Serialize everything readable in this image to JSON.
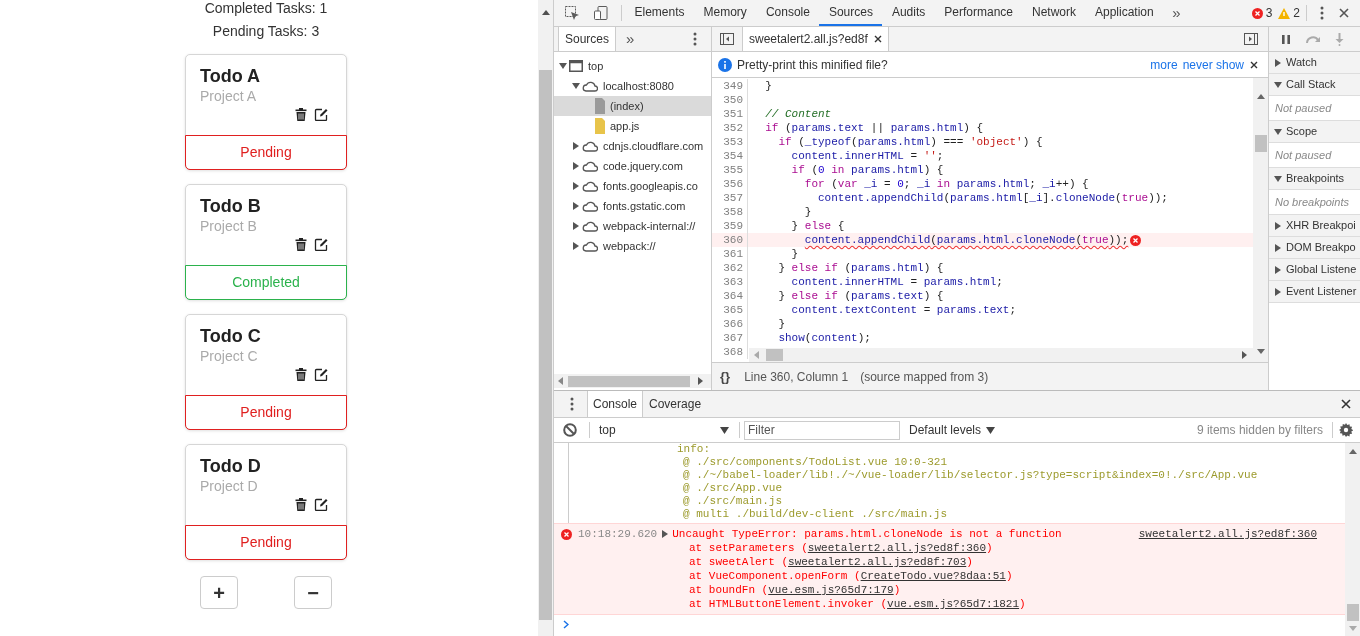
{
  "app": {
    "summary": [
      "Completed Tasks: 1",
      "Pending Tasks: 3"
    ],
    "todos": [
      {
        "title": "Todo A",
        "project": "Project A",
        "status": "Pending",
        "completed": false
      },
      {
        "title": "Todo B",
        "project": "Project B",
        "status": "Completed",
        "completed": true
      },
      {
        "title": "Todo C",
        "project": "Project C",
        "status": "Pending",
        "completed": false
      },
      {
        "title": "Todo D",
        "project": "Project D",
        "status": "Pending",
        "completed": false
      }
    ],
    "add_button": "+",
    "remove_button": "−"
  },
  "devtools": {
    "tabs": [
      {
        "label": "Elements",
        "selected": false
      },
      {
        "label": "Memory",
        "selected": false
      },
      {
        "label": "Console",
        "selected": false
      },
      {
        "label": "Sources",
        "selected": true
      },
      {
        "label": "Audits",
        "selected": false
      },
      {
        "label": "Performance",
        "selected": false
      },
      {
        "label": "Network",
        "selected": false
      },
      {
        "label": "Application",
        "selected": false
      }
    ],
    "more_tabs": "»",
    "error_count": "3",
    "warning_count": "2",
    "navigator": {
      "tab": "Sources",
      "more": "»",
      "tree": [
        {
          "label": "top",
          "kind": "frame",
          "expanded": true,
          "selected": false,
          "children": [
            {
              "label": "localhost:8080",
              "kind": "domain",
              "expanded": true,
              "selected": false,
              "children": [
                {
                  "label": "(index)",
                  "kind": "page",
                  "selected": true
                },
                {
                  "label": "app.js",
                  "kind": "script",
                  "selected": false
                }
              ]
            },
            {
              "label": "cdnjs.cloudflare.com",
              "kind": "domain",
              "expanded": false,
              "selected": false
            },
            {
              "label": "code.jquery.com",
              "kind": "domain",
              "expanded": false,
              "selected": false
            },
            {
              "label": "fonts.googleapis.co",
              "kind": "domain",
              "expanded": false,
              "selected": false
            },
            {
              "label": "fonts.gstatic.com",
              "kind": "domain",
              "expanded": false,
              "selected": false
            },
            {
              "label": "webpack-internal://",
              "kind": "domain",
              "expanded": false,
              "selected": false
            },
            {
              "label": "webpack://",
              "kind": "domain",
              "expanded": false,
              "selected": false
            }
          ]
        }
      ]
    },
    "editor": {
      "file_tab": "sweetalert2.all.js?ed8f",
      "infobar": {
        "message": "Pretty-print this minified file?",
        "links": [
          "more",
          "never show"
        ]
      },
      "lines": [
        {
          "number": "349",
          "error": false,
          "segments": [
            {
              "kind": "plain",
              "text": "  }"
            }
          ]
        },
        {
          "number": "350",
          "error": false
        },
        {
          "number": "351",
          "error": false,
          "segments": [
            {
              "kind": "comment",
              "text": "  // Content"
            }
          ]
        },
        {
          "number": "352",
          "error": false,
          "segments": [
            {
              "kind": "keyword",
              "text": "  if"
            },
            {
              "kind": "plain",
              "text": " ("
            },
            {
              "kind": "name",
              "text": "params.text"
            },
            {
              "kind": "plain",
              "text": " || "
            },
            {
              "kind": "name",
              "text": "params.html"
            },
            {
              "kind": "plain",
              "text": ") {"
            }
          ]
        },
        {
          "number": "353",
          "error": false,
          "segments": [
            {
              "kind": "keyword",
              "text": "    if"
            },
            {
              "kind": "plain",
              "text": " ("
            },
            {
              "kind": "name",
              "text": "_typeof"
            },
            {
              "kind": "plain",
              "text": "("
            },
            {
              "kind": "name",
              "text": "params.html"
            },
            {
              "kind": "plain",
              "text": ") === "
            },
            {
              "kind": "string",
              "text": "'object'"
            },
            {
              "kind": "plain",
              "text": ") {"
            }
          ]
        },
        {
          "number": "354",
          "error": false,
          "segments": [
            {
              "kind": "name",
              "text": "      content.innerHTML"
            },
            {
              "kind": "plain",
              "text": " = "
            },
            {
              "kind": "string",
              "text": "''"
            },
            {
              "kind": "plain",
              "text": ";"
            }
          ]
        },
        {
          "number": "355",
          "error": false,
          "segments": [
            {
              "kind": "keyword",
              "text": "      if"
            },
            {
              "kind": "plain",
              "text": " ("
            },
            {
              "kind": "number",
              "text": "0"
            },
            {
              "kind": "keyword",
              "text": " in "
            },
            {
              "kind": "name",
              "text": "params.html"
            },
            {
              "kind": "plain",
              "text": ") {"
            }
          ]
        },
        {
          "number": "356",
          "error": false,
          "segments": [
            {
              "kind": "keyword",
              "text": "        for"
            },
            {
              "kind": "plain",
              "text": " ("
            },
            {
              "kind": "keyword",
              "text": "var "
            },
            {
              "kind": "name",
              "text": "_i"
            },
            {
              "kind": "plain",
              "text": " = "
            },
            {
              "kind": "number",
              "text": "0"
            },
            {
              "kind": "plain",
              "text": "; "
            },
            {
              "kind": "name",
              "text": "_i"
            },
            {
              "kind": "keyword",
              "text": " in "
            },
            {
              "kind": "name",
              "text": "params.html"
            },
            {
              "kind": "plain",
              "text": "; "
            },
            {
              "kind": "name",
              "text": "_i"
            },
            {
              "kind": "plain",
              "text": "++) {"
            }
          ]
        },
        {
          "number": "357",
          "error": false,
          "segments": [
            {
              "kind": "name",
              "text": "          content.appendChild"
            },
            {
              "kind": "plain",
              "text": "("
            },
            {
              "kind": "name",
              "text": "params.html"
            },
            {
              "kind": "plain",
              "text": "["
            },
            {
              "kind": "name",
              "text": "_i"
            },
            {
              "kind": "plain",
              "text": "]."
            },
            {
              "kind": "name",
              "text": "cloneNode"
            },
            {
              "kind": "plain",
              "text": "("
            },
            {
              "kind": "keyword",
              "text": "true"
            },
            {
              "kind": "plain",
              "text": "));"
            }
          ]
        },
        {
          "number": "358",
          "error": false,
          "segments": [
            {
              "kind": "plain",
              "text": "        }"
            }
          ]
        },
        {
          "number": "359",
          "error": false,
          "segments": [
            {
              "kind": "plain",
              "text": "      } "
            },
            {
              "kind": "keyword",
              "text": "else"
            },
            {
              "kind": "plain",
              "text": " {"
            }
          ]
        },
        {
          "number": "360",
          "error": true,
          "segments": [
            {
              "kind": "name",
              "text": "        content.appendChild"
            },
            {
              "kind": "plain",
              "text": "("
            },
            {
              "kind": "name",
              "text": "params.html.cloneNode"
            },
            {
              "kind": "plain",
              "text": "("
            },
            {
              "kind": "keyword",
              "text": "true"
            },
            {
              "kind": "plain",
              "text": "));"
            }
          ]
        },
        {
          "number": "361",
          "error": false,
          "segments": [
            {
              "kind": "plain",
              "text": "      }"
            }
          ]
        },
        {
          "number": "362",
          "error": false,
          "segments": [
            {
              "kind": "plain",
              "text": "    } "
            },
            {
              "kind": "keyword",
              "text": "else if"
            },
            {
              "kind": "plain",
              "text": " ("
            },
            {
              "kind": "name",
              "text": "params.html"
            },
            {
              "kind": "plain",
              "text": ") {"
            }
          ]
        },
        {
          "number": "363",
          "error": false,
          "segments": [
            {
              "kind": "name",
              "text": "      content.innerHTML"
            },
            {
              "kind": "plain",
              "text": " = "
            },
            {
              "kind": "name",
              "text": "params.html"
            },
            {
              "kind": "plain",
              "text": ";"
            }
          ]
        },
        {
          "number": "364",
          "error": false,
          "segments": [
            {
              "kind": "plain",
              "text": "    } "
            },
            {
              "kind": "keyword",
              "text": "else if"
            },
            {
              "kind": "plain",
              "text": " ("
            },
            {
              "kind": "name",
              "text": "params.text"
            },
            {
              "kind": "plain",
              "text": ") {"
            }
          ]
        },
        {
          "number": "365",
          "error": false,
          "segments": [
            {
              "kind": "name",
              "text": "      content.textContent"
            },
            {
              "kind": "plain",
              "text": " = "
            },
            {
              "kind": "name",
              "text": "params.text"
            },
            {
              "kind": "plain",
              "text": ";"
            }
          ]
        },
        {
          "number": "366",
          "error": false,
          "segments": [
            {
              "kind": "plain",
              "text": "    }"
            }
          ]
        },
        {
          "number": "367",
          "error": false,
          "segments": [
            {
              "kind": "name",
              "text": "    show"
            },
            {
              "kind": "plain",
              "text": "("
            },
            {
              "kind": "name",
              "text": "content"
            },
            {
              "kind": "plain",
              "text": ");"
            }
          ]
        },
        {
          "number": "368",
          "error": false
        }
      ],
      "status": {
        "format_button": "{}",
        "position": "Line 360, Column 1",
        "source_map": "(source mapped from 3)"
      }
    },
    "debugger": {
      "sections": [
        {
          "title": "Watch",
          "expanded": false
        },
        {
          "title": "Call Stack",
          "expanded": true,
          "message": "Not paused"
        },
        {
          "title": "Scope",
          "expanded": true,
          "message": "Not paused"
        },
        {
          "title": "Breakpoints",
          "expanded": true,
          "message": "No breakpoints"
        },
        {
          "title": "XHR Breakpoi",
          "expanded": false
        },
        {
          "title": "DOM Breakpo",
          "expanded": false
        },
        {
          "title": "Global Listene",
          "expanded": false
        },
        {
          "title": "Event Listener",
          "expanded": false
        }
      ]
    },
    "drawer": {
      "tabs": [
        {
          "label": "Console",
          "selected": true
        },
        {
          "label": "Coverage",
          "selected": false
        }
      ],
      "context": "top",
      "filter_placeholder": "Filter",
      "levels": "Default levels",
      "hidden_note": "9 items hidden by filters",
      "messages": [
        {
          "kind": "info",
          "heading": "info:",
          "lines": [
            "@ ./src/components/TodoList.vue 10:0-321",
            "@ ./~/babel-loader/lib!./~/vue-loader/lib/selector.js?type=script&index=0!./src/App.vue",
            "@ ./src/App.vue",
            "@ ./src/main.js",
            "@ multi ./build/dev-client ./src/main.js"
          ]
        },
        {
          "kind": "error",
          "time": "10:18:29.620",
          "text": "Uncaught TypeError: params.html.cloneNode is not a function",
          "source": "sweetalert2.all.js?ed8f:360",
          "frames": [
            {
              "call": "at setParameters (",
              "location": "sweetalert2.all.js?ed8f:360",
              "close": ")"
            },
            {
              "call": "at sweetAlert (",
              "location": "sweetalert2.all.js?ed8f:703",
              "close": ")"
            },
            {
              "call": "at VueComponent.openForm (",
              "location": "CreateTodo.vue?8daa:51",
              "close": ")"
            },
            {
              "call": "at boundFn (",
              "location": "vue.esm.js?65d7:179",
              "close": ")"
            },
            {
              "call": "at HTMLButtonElement.invoker (",
              "location": "vue.esm.js?65d7:1821",
              "close": ")"
            }
          ]
        }
      ]
    }
  }
}
